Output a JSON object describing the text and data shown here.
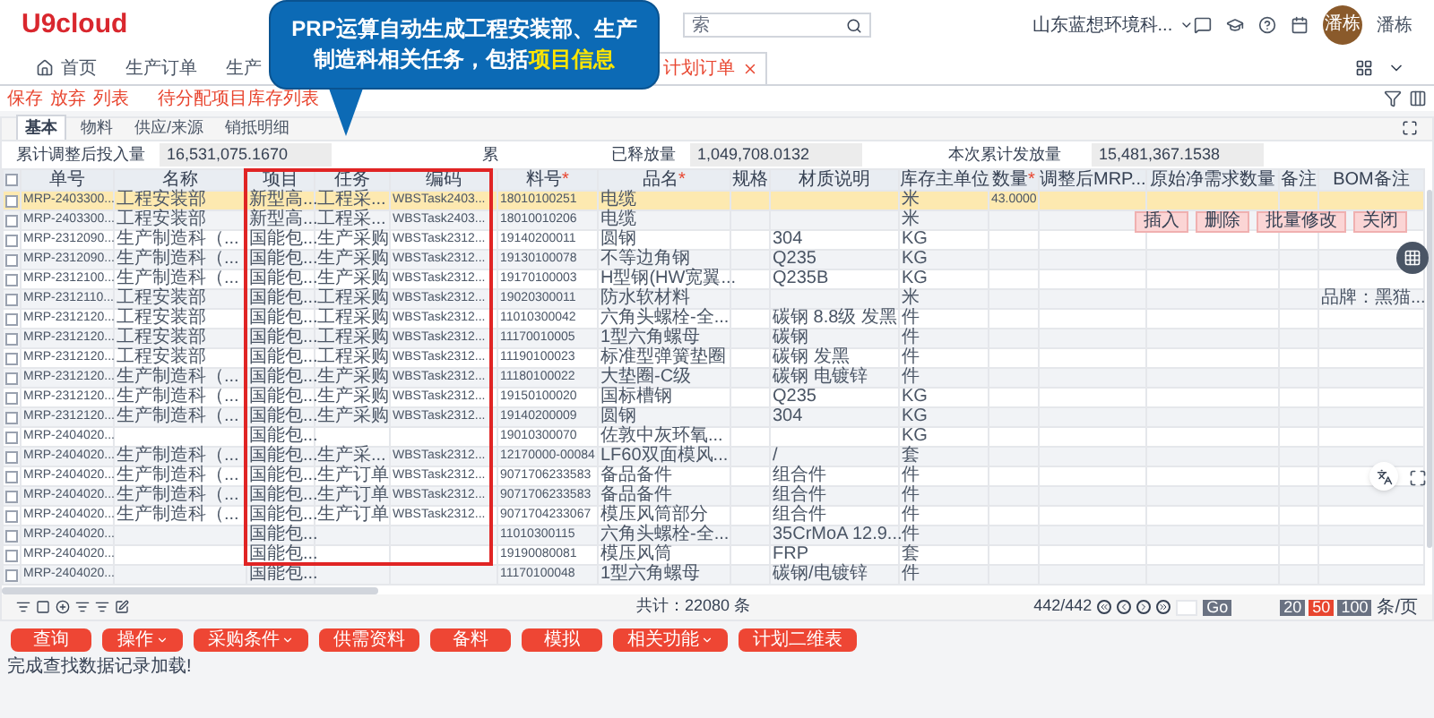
{
  "header": {
    "logo": "U9cloud",
    "search": {
      "placeholder": "索"
    },
    "company": "山东蓝想环境科...",
    "avatar": "潘栋",
    "user": "潘栋"
  },
  "tabs": [
    {
      "label": "首页",
      "kind": "home",
      "selected": false
    },
    {
      "label": "生产订单",
      "kind": "plain",
      "selected": false
    },
    {
      "label": "生产",
      "kind": "plain",
      "selected": false
    },
    {
      "label": "计划订单",
      "kind": "closable",
      "selected": true
    }
  ],
  "toolbar": [
    {
      "label": "保存"
    },
    {
      "label": "放弃"
    },
    {
      "label": "列表"
    },
    {
      "label": "待分配项目库存列表"
    }
  ],
  "subtabs": [
    {
      "label": "基本",
      "selected": true
    },
    {
      "label": "物料",
      "selected": false
    },
    {
      "label": "供应/来源",
      "selected": false
    },
    {
      "label": "销抵明细",
      "selected": false
    }
  ],
  "fields": [
    {
      "label": "累计调整后投入量",
      "value": "16,531,075.1670"
    },
    {
      "label": "累",
      "label_2": "已释放量",
      "value": "1,049,708.0132"
    },
    {
      "label": "本次累计发放量",
      "value": "15,481,367.1538"
    }
  ],
  "table": {
    "all_checked": false,
    "columns": [
      {
        "label": "单号"
      },
      {
        "label": "名称"
      },
      {
        "label": "项目"
      },
      {
        "label": "任务"
      },
      {
        "label": "编码"
      },
      {
        "label": "料号",
        "mark": "*"
      },
      {
        "label": "品名",
        "mark": "*"
      },
      {
        "label": "规格"
      },
      {
        "label": "材质说明"
      },
      {
        "label": "库存主单位"
      },
      {
        "label": "数量",
        "mark": "*"
      },
      {
        "label": "调整后MRP..."
      },
      {
        "label": "原始净需求数量"
      },
      {
        "label": "备注"
      },
      {
        "label": "BOM备注"
      }
    ],
    "rows": [
      {
        "selected": true,
        "checked": false,
        "cells": [
          "MRP-2403300...",
          "工程安装部",
          "新型高...",
          "工程采...",
          "WBSTask2403...",
          "18010100251",
          "电缆",
          null,
          null,
          "米",
          "43.0000",
          null,
          null,
          null,
          null
        ]
      },
      {
        "selected": false,
        "checked": false,
        "cells": [
          "MRP-2403300...",
          "工程安装部",
          "新型高...",
          "工程采...",
          "WBSTask2403...",
          "18010010206",
          "电缆",
          null,
          null,
          "米",
          null,
          null,
          null,
          null,
          null
        ]
      },
      {
        "selected": false,
        "checked": false,
        "cells": [
          "MRP-2312090...",
          "生产制造科（...",
          "国能包...",
          "生产采购",
          "WBSTask2312...",
          "19140200011",
          "圆钢",
          null,
          "304",
          "KG",
          null,
          null,
          null,
          null,
          null
        ]
      },
      {
        "selected": false,
        "checked": false,
        "cells": [
          "MRP-2312090...",
          "生产制造科（...",
          "国能包...",
          "生产采购",
          "WBSTask2312...",
          "19130100078",
          "不等边角钢",
          null,
          "Q235",
          "KG",
          null,
          null,
          null,
          null,
          null
        ]
      },
      {
        "selected": false,
        "checked": false,
        "cells": [
          "MRP-2312100...",
          "生产制造科（...",
          "国能包...",
          "生产采购",
          "WBSTask2312...",
          "19170100003",
          "H型钢(HW宽翼...",
          null,
          "Q235B",
          "KG",
          null,
          null,
          null,
          null,
          null
        ]
      },
      {
        "selected": false,
        "checked": false,
        "cells": [
          "MRP-2312110...",
          "工程安装部",
          "国能包...",
          "工程采购",
          "WBSTask2312...",
          "19020300011",
          "防水软材料",
          null,
          null,
          "米",
          null,
          null,
          null,
          null,
          "品牌：黑猫..."
        ]
      },
      {
        "selected": false,
        "checked": false,
        "cells": [
          "MRP-2312120...",
          "工程安装部",
          "国能包...",
          "工程采购",
          "WBSTask2312...",
          "11010300042",
          "六角头螺栓-全...",
          null,
          "碳钢 8.8级 发黑",
          "件",
          null,
          null,
          null,
          null,
          null
        ]
      },
      {
        "selected": false,
        "checked": false,
        "cells": [
          "MRP-2312120...",
          "工程安装部",
          "国能包...",
          "工程采购",
          "WBSTask2312...",
          "11170010005",
          "1型六角螺母",
          null,
          "碳钢",
          "件",
          null,
          null,
          null,
          null,
          null
        ]
      },
      {
        "selected": false,
        "checked": false,
        "cells": [
          "MRP-2312120...",
          "工程安装部",
          "国能包...",
          "工程采购",
          "WBSTask2312...",
          "11190100023",
          "标准型弹簧垫圈",
          null,
          "碳钢 发黑",
          "件",
          null,
          null,
          null,
          null,
          null
        ]
      },
      {
        "selected": false,
        "checked": false,
        "cells": [
          "MRP-2312120...",
          "生产制造科（...",
          "国能包...",
          "生产采购",
          "WBSTask2312...",
          "11180100022",
          "大垫圈-C级",
          null,
          "碳钢 电镀锌",
          "件",
          null,
          null,
          null,
          null,
          null
        ]
      },
      {
        "selected": false,
        "checked": false,
        "cells": [
          "MRP-2312120...",
          "生产制造科（...",
          "国能包...",
          "生产采购",
          "WBSTask2312...",
          "19150100020",
          "国标槽钢",
          null,
          "Q235",
          "KG",
          null,
          null,
          null,
          null,
          null
        ]
      },
      {
        "selected": false,
        "checked": false,
        "cells": [
          "MRP-2312120...",
          "生产制造科（...",
          "国能包...",
          "生产采购",
          "WBSTask2312...",
          "19140200009",
          "圆钢",
          null,
          "304",
          "KG",
          null,
          null,
          null,
          null,
          null
        ]
      },
      {
        "selected": false,
        "checked": false,
        "cells": [
          "MRP-2404020...",
          null,
          "国能包...",
          null,
          null,
          "19010300070",
          "佐敦中灰环氧...",
          null,
          null,
          "KG",
          null,
          null,
          null,
          null,
          null
        ]
      },
      {
        "selected": false,
        "checked": false,
        "cells": [
          "MRP-2404020...",
          "生产制造科（...",
          "国能包...",
          "生产采...",
          "WBSTask2312...",
          "12170000-00084",
          "LF60双面模风...",
          null,
          "/",
          "套",
          null,
          null,
          null,
          null,
          null
        ]
      },
      {
        "selected": false,
        "checked": false,
        "cells": [
          "MRP-2404020...",
          "生产制造科（...",
          "国能包...",
          "生产订单",
          "WBSTask2312...",
          "9071706233583",
          "备品备件",
          null,
          "组合件",
          "件",
          null,
          null,
          null,
          null,
          null
        ]
      },
      {
        "selected": false,
        "checked": false,
        "cells": [
          "MRP-2404020...",
          "生产制造科（...",
          "国能包...",
          "生产订单",
          "WBSTask2312...",
          "9071706233583",
          "备品备件",
          null,
          "组合件",
          "件",
          null,
          null,
          null,
          null,
          null
        ]
      },
      {
        "selected": false,
        "checked": false,
        "cells": [
          "MRP-2404020...",
          "生产制造科（...",
          "国能包...",
          "生产订单",
          "WBSTask2312...",
          "9071704233067",
          "模压风筒部分",
          null,
          "组合件",
          "件",
          null,
          null,
          null,
          null,
          null
        ]
      },
      {
        "selected": false,
        "checked": false,
        "cells": [
          "MRP-2404020...",
          null,
          "国能包...",
          null,
          null,
          "11010300115",
          "六角头螺栓-全...",
          null,
          "35CrMoA 12.9...",
          "件",
          null,
          null,
          null,
          null,
          null
        ]
      },
      {
        "selected": false,
        "checked": false,
        "cells": [
          "MRP-2404020...",
          null,
          "国能包...",
          null,
          null,
          "19190080081",
          "模压风筒",
          null,
          "FRP",
          "套",
          null,
          null,
          null,
          null,
          null
        ]
      },
      {
        "selected": false,
        "checked": false,
        "cells": [
          "MRP-2404020...",
          null,
          "国能包...",
          null,
          null,
          "11170100048",
          "1型六角螺母",
          null,
          "碳钢/电镀锌",
          "件",
          null,
          null,
          null,
          null,
          null
        ]
      }
    ],
    "row_actions": [
      "插入",
      "删除",
      "批量修改",
      "关闭"
    ]
  },
  "pager": {
    "total": "共计：22080 条",
    "position": "442/442",
    "go": "Go",
    "sizes": [
      {
        "label": "20",
        "selected": false
      },
      {
        "label": "50",
        "selected": true
      },
      {
        "label": "100",
        "selected": false
      }
    ],
    "unit": "条/页"
  },
  "actions": [
    {
      "label": "查询",
      "dropdown": false
    },
    {
      "label": "操作",
      "dropdown": true
    },
    {
      "label": "采购条件",
      "dropdown": true
    },
    {
      "label": "供需资料",
      "dropdown": false
    },
    {
      "label": "备料",
      "dropdown": false
    },
    {
      "label": "模拟",
      "dropdown": false
    },
    {
      "label": "相关功能",
      "dropdown": true
    },
    {
      "label": "计划二维表",
      "dropdown": false
    }
  ],
  "status": "完成查找数据记录加载!",
  "callout": {
    "text": "PRP运算自动生成工程安装部、生产制造科相关任务，包括",
    "highlight": "项目信息"
  }
}
